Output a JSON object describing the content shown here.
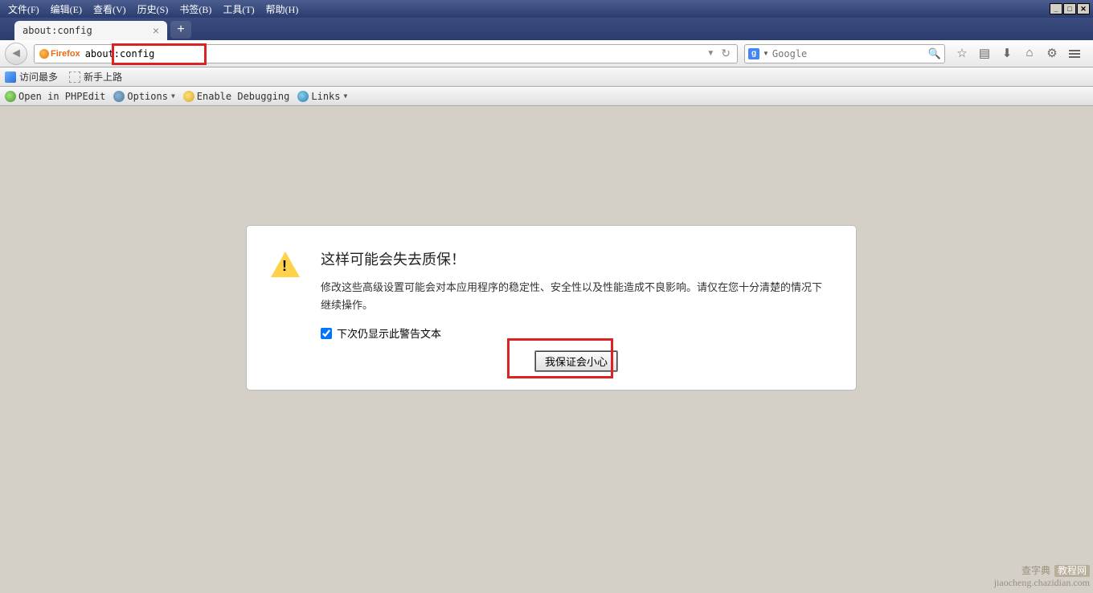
{
  "menubar": {
    "items": [
      "文件(F)",
      "编辑(E)",
      "查看(V)",
      "历史(S)",
      "书签(B)",
      "工具(T)",
      "帮助(H)"
    ]
  },
  "tab": {
    "title": "about:config"
  },
  "urlbar": {
    "chip": "Firefox",
    "value": "about:config"
  },
  "searchbar": {
    "placeholder": "Google"
  },
  "bookmarks": {
    "mostvisited": "访问最多",
    "gettingstarted": "新手上路"
  },
  "addonbar": {
    "phpedit": "Open in PHPEdit",
    "options": "Options",
    "debug": "Enable Debugging",
    "links": "Links"
  },
  "warning": {
    "title": "这样可能会失去质保！",
    "text": "修改这些高级设置可能会对本应用程序的稳定性、安全性以及性能造成不良影响。请仅在您十分清楚的情况下继续操作。",
    "checkbox": "下次仍显示此警告文本",
    "button": "我保证会小心"
  },
  "watermark": {
    "line1": "查字典",
    "badge": "教程网",
    "line2": "jiaocheng.chazidian.com"
  }
}
